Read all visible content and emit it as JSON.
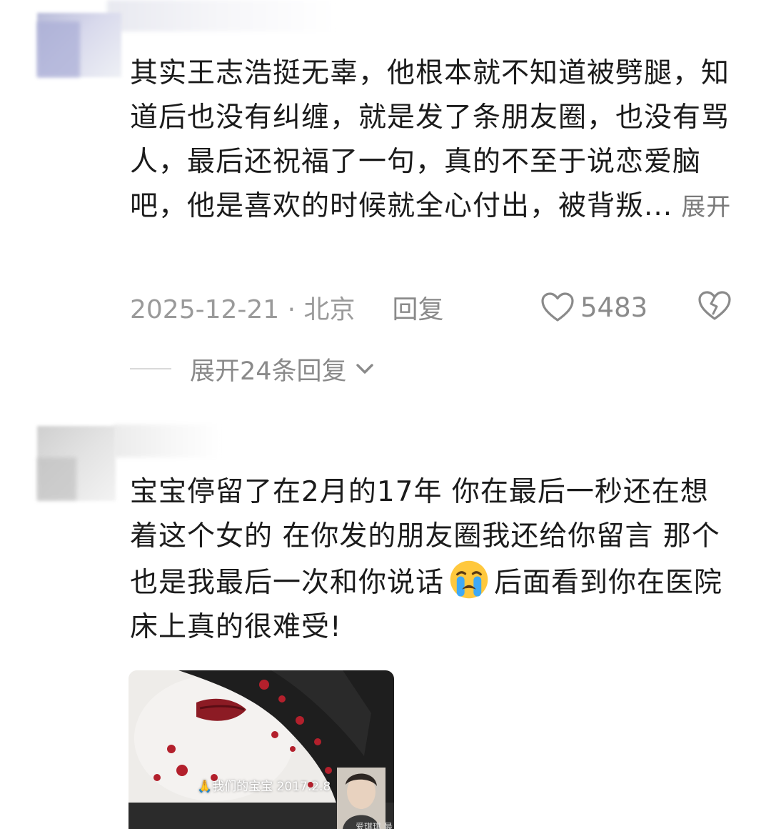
{
  "comments": [
    {
      "text": "其实王志浩挺无辜，他根本就不知道被劈腿，知道后也没有纠缠，就是发了条朋友圈，也没有骂人，最后还祝福了一句，真的不至于说恋爱脑吧，他是喜欢的时候就全心付出，被背叛...",
      "expand_label": "展开",
      "date_location": "2025-12-21 · 北京",
      "reply_label": "回复",
      "like_count": "5483",
      "replies_label": "展开24条回复"
    },
    {
      "text_before_emoji": "宝宝停留了在2月的17年 你在最后一秒还在想着这个女的 在你发的朋友圈我还给你留言 那个也是我最后一次和你说话",
      "emoji": "loudly-crying-face",
      "text_after_emoji": "后面看到你在医院床上真的很难受!",
      "photo": {
        "caption": "🙏我们的宝宝 2017.2.8",
        "sub_caption": "爱琪琪 最美好"
      }
    }
  ],
  "colors": {
    "text": "#1b1b1b",
    "meta": "#9a9a9a",
    "link": "#7a7a7a"
  }
}
